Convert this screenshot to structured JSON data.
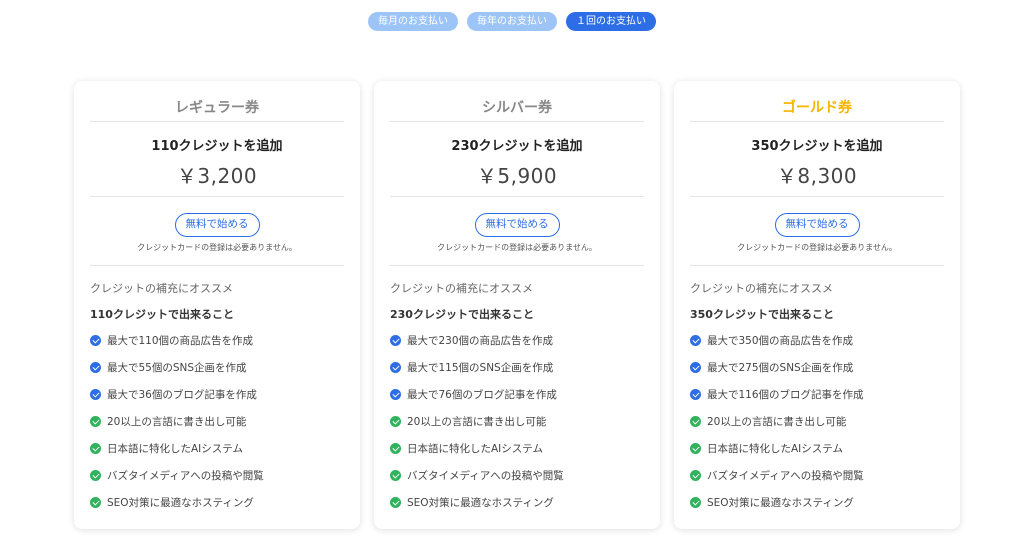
{
  "billing_tabs": [
    {
      "label": "毎月のお支払い"
    },
    {
      "label": "毎年のお支払い"
    },
    {
      "label": "１回のお支払い"
    }
  ],
  "plans": [
    {
      "name": "レギュラー券",
      "credits_add": "110クレジットを追加",
      "price": "￥3,200",
      "start_label": "無料で始める",
      "no_card": "クレジットカードの登録は必要ありません。",
      "recommend": "クレジットの補充にオススメ",
      "cando": "110クレジットで出来ること",
      "features": [
        "最大で110個の商品広告を作成",
        "最大で55個のSNS企画を作成",
        "最大で36個のブログ記事を作成",
        "20以上の言語に書き出し可能",
        "日本語に特化したAIシステム",
        "バズタイメディアへの投稿や閲覧",
        "SEO対策に最適なホスティング"
      ]
    },
    {
      "name": "シルバー券",
      "credits_add": "230クレジットを追加",
      "price": "￥5,900",
      "start_label": "無料で始める",
      "no_card": "クレジットカードの登録は必要ありません。",
      "recommend": "クレジットの補充にオススメ",
      "cando": "230クレジットで出来ること",
      "features": [
        "最大で230個の商品広告を作成",
        "最大で115個のSNS企画を作成",
        "最大で76個のブログ記事を作成",
        "20以上の言語に書き出し可能",
        "日本語に特化したAIシステム",
        "バズタイメディアへの投稿や閲覧",
        "SEO対策に最適なホスティング"
      ]
    },
    {
      "name": "ゴールド券",
      "credits_add": "350クレジットを追加",
      "price": "￥8,300",
      "start_label": "無料で始める",
      "no_card": "クレジットカードの登録は必要ありません。",
      "recommend": "クレジットの補充にオススメ",
      "cando": "350クレジットで出来ること",
      "features": [
        "最大で350個の商品広告を作成",
        "最大で275個のSNS企画を作成",
        "最大で116個のブログ記事を作成",
        "20以上の言語に書き出し可能",
        "日本語に特化したAIシステム",
        "バズタイメディアへの投稿や閲覧",
        "SEO対策に最適なホスティング"
      ]
    }
  ],
  "colors": {
    "accent_blue": "#2d6ee6",
    "tab_inactive": "#9dc4f7",
    "check_green": "#2fb35c",
    "gold_title": "#f5b400"
  },
  "icons": {
    "usage_feature": "blue-check-circle-icon",
    "general_feature": "green-check-circle-icon"
  }
}
